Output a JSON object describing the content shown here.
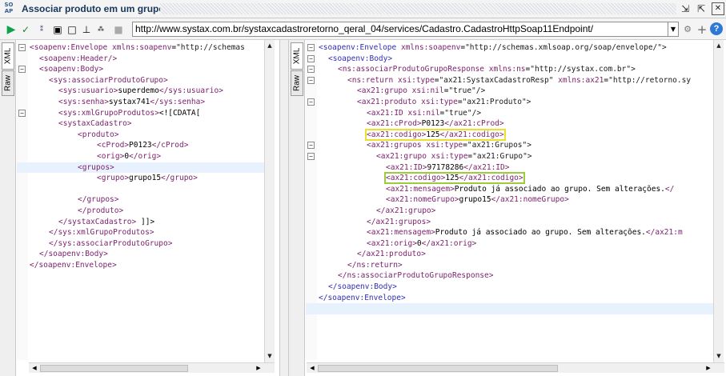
{
  "window": {
    "icon_label": "SO AP",
    "title": "Associar produto em um grupo"
  },
  "toolbar": {
    "endpoint_url": "http://www.systax.com.br/systaxcadastroretorno_qeral_04/services/Cadastro.CadastroHttpSoap11Endpoint/",
    "icons": [
      "play-icon",
      "validate-icon",
      "format-icon",
      "editor-icon",
      "stop-icon",
      "insert-icon",
      "options-icon"
    ]
  },
  "request_pane": {
    "tabs": [
      "XML",
      "Raw"
    ],
    "active_tab": "XML",
    "lines": [
      {
        "indent": 0,
        "html": "<span class='tag'>&lt;soapenv:Envelope</span> <span class='attr'>xmlns:soapenv</span>=<span class='val'>\"http://schemas</span>"
      },
      {
        "indent": 1,
        "html": "<span class='tag'>&lt;soapenv:Header/&gt;</span>"
      },
      {
        "indent": 1,
        "html": "<span class='tag'>&lt;soapenv:Body&gt;</span>"
      },
      {
        "indent": 2,
        "html": "<span class='tag'>&lt;sys:associarProdutoGrupo&gt;</span>"
      },
      {
        "indent": 3,
        "html": "<span class='tag'>&lt;sys:usuario&gt;</span><span class='txt'>superdemo</span><span class='tag'>&lt;/sys:usuario&gt;</span>"
      },
      {
        "indent": 3,
        "html": "<span class='tag'>&lt;sys:senha&gt;</span><span class='txt'>systax741</span><span class='tag'>&lt;/sys:senha&gt;</span>"
      },
      {
        "indent": 3,
        "html": "<span class='tag'>&lt;sys:xmlGrupoProdutos&gt;</span><span class='txt'>&lt;![CDATA[</span>"
      },
      {
        "indent": 3,
        "html": "<span class='tag'>&lt;systaxCadastro&gt;</span>"
      },
      {
        "indent": 5,
        "html": "<span class='tag'>&lt;produto&gt;</span>"
      },
      {
        "indent": 7,
        "html": "<span class='tag'>&lt;cProd&gt;</span><span class='txt'>P0123</span><span class='tag'>&lt;/cProd&gt;</span>"
      },
      {
        "indent": 7,
        "html": "<span class='tag'>&lt;orig&gt;</span><span class='txt'>0</span><span class='tag'>&lt;/orig&gt;</span>"
      },
      {
        "indent": 5,
        "html": "<span class='tag'>&lt;grupos&gt;</span>"
      },
      {
        "indent": 7,
        "html": "<span class='tag'>&lt;grupo&gt;</span><span class='txt'>grupo15</span><span class='tag'>&lt;/grupo&gt;</span>"
      },
      {
        "indent": 0,
        "html": ""
      },
      {
        "indent": 5,
        "html": "<span class='tag'>&lt;/grupos&gt;</span>"
      },
      {
        "indent": 5,
        "html": "<span class='tag'>&lt;/produto&gt;</span>"
      },
      {
        "indent": 3,
        "html": "<span class='tag'>&lt;/systaxCadastro&gt;</span> <span class='txt'>]]&gt;</span>"
      },
      {
        "indent": 2,
        "html": "<span class='tag'>&lt;/sys:xmlGrupoProdutos&gt;</span>"
      },
      {
        "indent": 2,
        "html": "<span class='tag'>&lt;/sys:associarProdutoGrupo&gt;</span>"
      },
      {
        "indent": 1,
        "html": "<span class='tag'>&lt;/soapenv:Body&gt;</span>"
      },
      {
        "indent": 0,
        "html": "<span class='tag'>&lt;/soapenv:Envelope&gt;</span>"
      }
    ]
  },
  "response_pane": {
    "tabs": [
      "XML",
      "Raw"
    ],
    "active_tab": "XML",
    "lines": [
      {
        "indent": 0,
        "html": "<span class='tag blue'>&lt;soapenv:Envelope</span> <span class='attr'>xmlns:soapenv</span>=<span class='val'>\"http://schemas.xmlsoap.org/soap/envelope/\"&gt;</span>"
      },
      {
        "indent": 1,
        "html": "<span class='tag blue'>&lt;soapenv:Body&gt;</span>"
      },
      {
        "indent": 2,
        "html": "<span class='tag'>&lt;ns:associarProdutoGrupoResponse</span> <span class='attr'>xmlns:ns</span>=<span class='val'>\"http://systax.com.br\"&gt;</span>"
      },
      {
        "indent": 3,
        "html": "<span class='tag'>&lt;ns:return</span> <span class='attr'>xsi:type</span>=<span class='val'>\"ax21:SystaxCadastroResp\"</span> <span class='attr'>xmlns:ax21</span>=<span class='val'>\"http://retorno.sy</span>"
      },
      {
        "indent": 4,
        "html": "<span class='tag'>&lt;ax21:grupo</span> <span class='attr'>xsi:nil</span>=<span class='val'>\"true\"/&gt;</span>"
      },
      {
        "indent": 4,
        "html": "<span class='tag'>&lt;ax21:produto</span> <span class='attr'>xsi:type</span>=<span class='val'>\"ax21:Produto\"&gt;</span>"
      },
      {
        "indent": 5,
        "html": "<span class='tag'>&lt;ax21:ID</span> <span class='attr'>xsi:nil</span>=<span class='val'>\"true\"/&gt;</span>"
      },
      {
        "indent": 5,
        "html": "<span class='tag'>&lt;ax21:cProd&gt;</span><span class='txt'>P0123</span><span class='tag'>&lt;/ax21:cProd&gt;</span>"
      },
      {
        "indent": 5,
        "box": "yellow",
        "html": "<span class='tag'>&lt;ax21:codigo&gt;</span><span class='txt'>125</span><span class='tag'>&lt;/ax21:codigo&gt;</span>"
      },
      {
        "indent": 5,
        "html": "<span class='tag'>&lt;ax21:grupos</span> <span class='attr'>xsi:type</span>=<span class='val'>\"ax21:Grupos\"&gt;</span>"
      },
      {
        "indent": 6,
        "html": "<span class='tag'>&lt;ax21:grupo</span> <span class='attr'>xsi:type</span>=<span class='val'>\"ax21:Grupo\"&gt;</span>"
      },
      {
        "indent": 7,
        "html": "<span class='tag'>&lt;ax21:ID&gt;</span><span class='txt'>97178286</span><span class='tag'>&lt;/ax21:ID&gt;</span>"
      },
      {
        "indent": 7,
        "box": "green",
        "html": "<span class='tag'>&lt;ax21:codigo&gt;</span><span class='txt'>125</span><span class='tag'>&lt;/ax21:codigo&gt;</span>"
      },
      {
        "indent": 7,
        "html": "<span class='tag'>&lt;ax21:mensagem&gt;</span><span class='txt'>Produto já associado ao grupo. Sem alterações.</span><span class='tag'>&lt;/</span>"
      },
      {
        "indent": 7,
        "html": "<span class='tag'>&lt;ax21:nomeGrupo&gt;</span><span class='txt'>grupo15</span><span class='tag'>&lt;/ax21:nomeGrupo&gt;</span>"
      },
      {
        "indent": 6,
        "html": "<span class='tag'>&lt;/ax21:grupo&gt;</span>"
      },
      {
        "indent": 5,
        "html": "<span class='tag'>&lt;/ax21:grupos&gt;</span>"
      },
      {
        "indent": 5,
        "html": "<span class='tag'>&lt;ax21:mensagem&gt;</span><span class='txt'>Produto já associado ao grupo. Sem alterações.</span><span class='tag'>&lt;/ax21:m</span>"
      },
      {
        "indent": 5,
        "html": "<span class='tag'>&lt;ax21:orig&gt;</span><span class='txt'>0</span><span class='tag'>&lt;/ax21:orig&gt;</span>"
      },
      {
        "indent": 4,
        "html": "<span class='tag'>&lt;/ax21:produto&gt;</span>"
      },
      {
        "indent": 3,
        "html": "<span class='tag'>&lt;/ns:return&gt;</span>"
      },
      {
        "indent": 2,
        "html": "<span class='tag'>&lt;/ns:associarProdutoGrupoResponse&gt;</span>"
      },
      {
        "indent": 1,
        "html": "<span class='tag blue'>&lt;/soapenv:Body&gt;</span>"
      },
      {
        "indent": 0,
        "html": "<span class='tag blue'>&lt;/soapenv:Envelope&gt;</span>"
      }
    ]
  },
  "colors": {
    "highlight_yellow": "#ece02f",
    "highlight_green": "#9ccc3c",
    "xml_tag": "#7a1f6a",
    "envelope_tag": "#2f2fb5"
  }
}
